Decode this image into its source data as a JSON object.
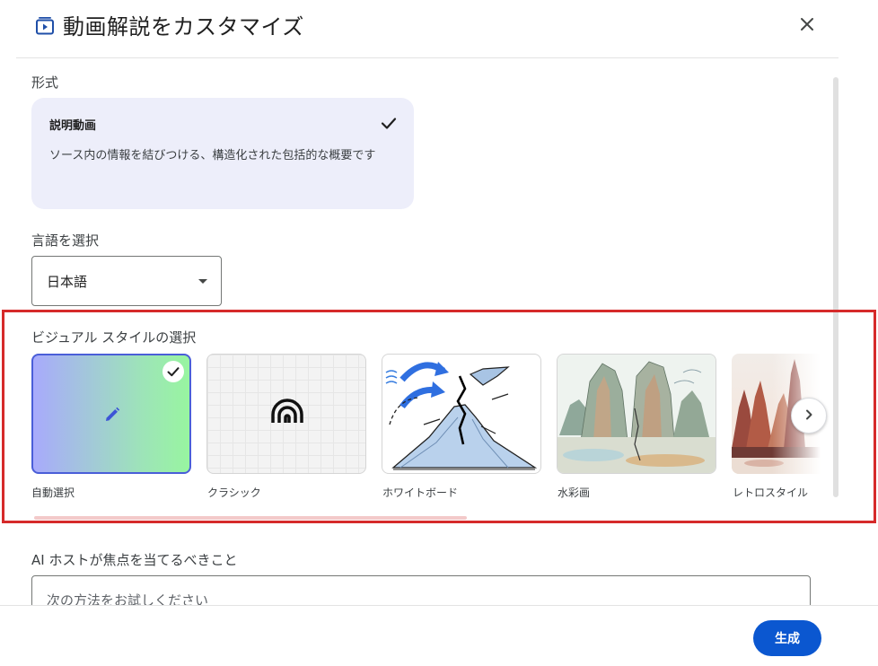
{
  "header": {
    "title": "動画解説をカスタマイズ",
    "title_icon": "video-overview-icon",
    "close_icon": "close-icon"
  },
  "format": {
    "label": "形式",
    "option_name": "説明動画",
    "option_description": "ソース内の情報を結びつける、構造化された包括的な概要です",
    "selected": true
  },
  "language": {
    "label": "言語を選択",
    "value": "日本語"
  },
  "visual_style": {
    "label": "ビジュアル スタイルの選択",
    "items": [
      {
        "label": "自動選択",
        "icon": "pencil-icon",
        "selected": true
      },
      {
        "label": "クラシック",
        "icon": "arch-logo-icon",
        "selected": false
      },
      {
        "label": "ホワイトボード",
        "icon": "whiteboard-volcano-image",
        "selected": false
      },
      {
        "label": "水彩画",
        "icon": "watercolor-mountains-image",
        "selected": false
      },
      {
        "label": "レトロスタイル",
        "icon": "retro-mountains-image",
        "selected": false
      }
    ],
    "next_icon": "chevron-right-icon"
  },
  "focus": {
    "label": "AI ホストが焦点を当てるべきこと",
    "placeholder": "次の方法をお試しください"
  },
  "footer": {
    "generate_label": "生成"
  },
  "colors": {
    "primary": "#0b57d0",
    "format_card_bg": "#edeefa",
    "highlight_border": "#d62a2a"
  }
}
